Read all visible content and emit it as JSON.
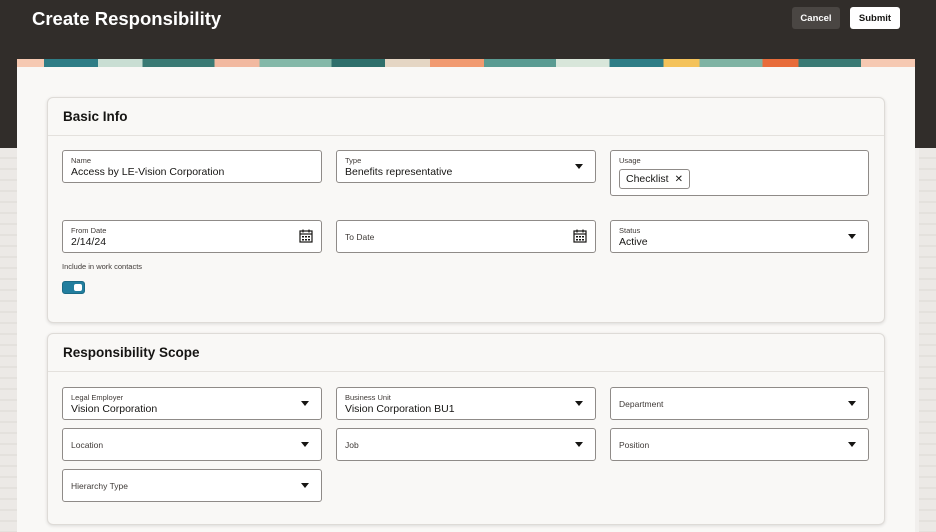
{
  "header": {
    "title": "Create Responsibility",
    "cancel_label": "Cancel",
    "submit_label": "Submit"
  },
  "basic_info": {
    "heading": "Basic Info",
    "name": {
      "label": "Name",
      "value": "Access by LE-Vision Corporation"
    },
    "type": {
      "label": "Type",
      "value": "Benefits representative"
    },
    "usage": {
      "label": "Usage",
      "chips": [
        "Checklist"
      ],
      "remove_glyph": "✕"
    },
    "from_date": {
      "label": "From Date",
      "value": "2/14/24"
    },
    "to_date": {
      "label": "To Date"
    },
    "status": {
      "label": "Status",
      "value": "Active"
    },
    "include_work_contacts": {
      "label": "Include in work contacts",
      "on": true
    }
  },
  "scope": {
    "heading": "Responsibility Scope",
    "legal_employer": {
      "label": "Legal Employer",
      "value": "Vision Corporation"
    },
    "business_unit": {
      "label": "Business Unit",
      "value": "Vision Corporation BU1"
    },
    "department": {
      "label": "Department"
    },
    "location": {
      "label": "Location"
    },
    "job": {
      "label": "Job"
    },
    "position": {
      "label": "Position"
    },
    "hierarchy_type": {
      "label": "Hierarchy Type"
    }
  },
  "icons": {
    "calendar": "calendar-icon",
    "dropdown": "chevron-down-icon",
    "remove": "close-icon"
  },
  "colors": {
    "header_bg": "#312d2a",
    "toggle_on": "#227e9e",
    "submit_bg": "#ffffff"
  }
}
